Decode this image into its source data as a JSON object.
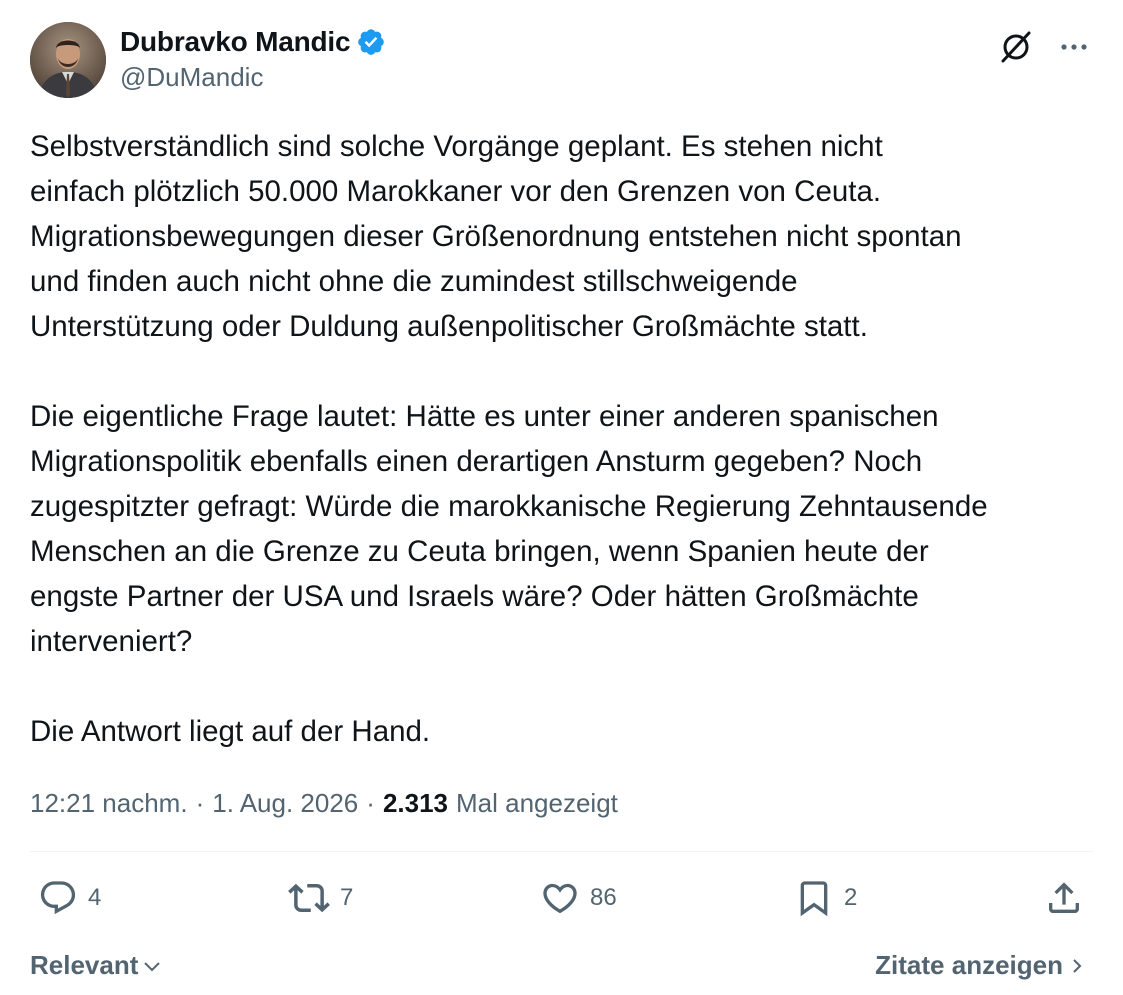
{
  "author": {
    "display_name": "Dubravko Mandic",
    "handle": "@DuMandic",
    "verified_icon": "verified-badge-icon",
    "verified_color": "#1d9bf0"
  },
  "post": {
    "text": "Selbstverständlich sind solche Vorgänge geplant. Es stehen nicht\neinfach plötzlich 50.000 Marokkaner vor den Grenzen von Ceuta.\nMigrationsbewegungen dieser Größenordnung entstehen nicht spontan\nund finden auch nicht ohne die zumindest stillschweigende\nUnterstützung oder Duldung außenpolitischer Großmächte statt.\n\nDie eigentliche Frage lautet: Hätte es unter einer anderen spanischen\nMigrationspolitik ebenfalls einen derartigen Ansturm gegeben? Noch\nzugespitzter gefragt: Würde die marokkanische Regierung Zehntausende\nMenschen an die Grenze zu Ceuta bringen, wenn Spanien heute der\nengste Partner der USA und Israels wäre? Oder hätten Großmächte\ninterveniert?\n\nDie Antwort liegt auf der Hand.",
    "time": "12:21 nachm.",
    "separator": "·",
    "date": "1. Aug. 2026",
    "views_count": "2.313",
    "views_label": "Mal angezeigt"
  },
  "actions": {
    "replies": "4",
    "reposts": "7",
    "likes": "86",
    "bookmarks": "2"
  },
  "footer": {
    "sort_label": "Relevant",
    "quotes_label": "Zitate anzeigen"
  },
  "colors": {
    "text_primary": "#0f1419",
    "text_secondary": "#536471",
    "divider": "#eff3f4",
    "accent": "#1d9bf0"
  }
}
